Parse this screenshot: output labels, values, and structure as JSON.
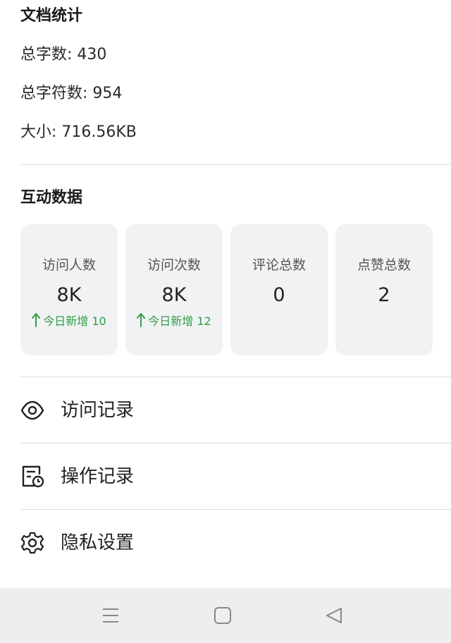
{
  "doc_stats": {
    "title": "文档统计",
    "word_count": "总字数: 430",
    "char_count": "总字符数: 954",
    "size": "大小: 716.56KB"
  },
  "interaction": {
    "title": "互动数据",
    "cards": [
      {
        "label": "访问人数",
        "value": "8K",
        "delta": "今日新增 10",
        "delta_icon": "arrow-up-icon"
      },
      {
        "label": "访问次数",
        "value": "8K",
        "delta": "今日新增 12",
        "delta_icon": "arrow-up-icon"
      },
      {
        "label": "评论总数",
        "value": "0"
      },
      {
        "label": "点赞总数",
        "value": "2"
      }
    ]
  },
  "menu": [
    {
      "label": "访问记录",
      "icon": "eye-icon"
    },
    {
      "label": "操作记录",
      "icon": "document-clock-icon"
    },
    {
      "label": "隐私设置",
      "icon": "gear-icon"
    }
  ],
  "navbar": {
    "buttons": [
      "menu-icon",
      "home-icon",
      "back-icon"
    ]
  },
  "colors": {
    "accent_green": "#2e9e46",
    "card_bg": "#f1f2f4",
    "navbar_bg": "#eeeeee"
  }
}
